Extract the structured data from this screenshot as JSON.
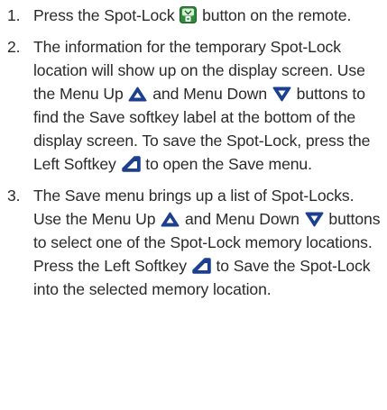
{
  "steps": [
    {
      "number": "1.",
      "parts": [
        "Press the Spot-Lock ",
        " button on the remote."
      ]
    },
    {
      "number": "2.",
      "parts": [
        "The information for the temporary Spot-Lock location will show up on the display screen. Use the Menu Up ",
        " and Menu Down ",
        " buttons to find the Save softkey label at the bottom of the display screen. To save the Spot-Lock, press the Left Softkey ",
        " to open the Save menu."
      ]
    },
    {
      "number": "3.",
      "parts": [
        "The Save menu brings up a list of Spot-Locks. Use the Menu Up ",
        " and Menu Down ",
        " buttons to select one of the Spot-Lock memory locations. Press the Left Softkey ",
        " to Save the Spot-Lock into the selected memory location."
      ]
    }
  ],
  "icons": {
    "spot_lock": "spot-lock-icon",
    "menu_up": "menu-up-icon",
    "menu_down": "menu-down-icon",
    "left_softkey": "left-softkey-icon"
  },
  "colors": {
    "text": "#2a2a2a",
    "spot_lock_green": "#2e8b3a",
    "button_blue": "#1c3f8f"
  }
}
